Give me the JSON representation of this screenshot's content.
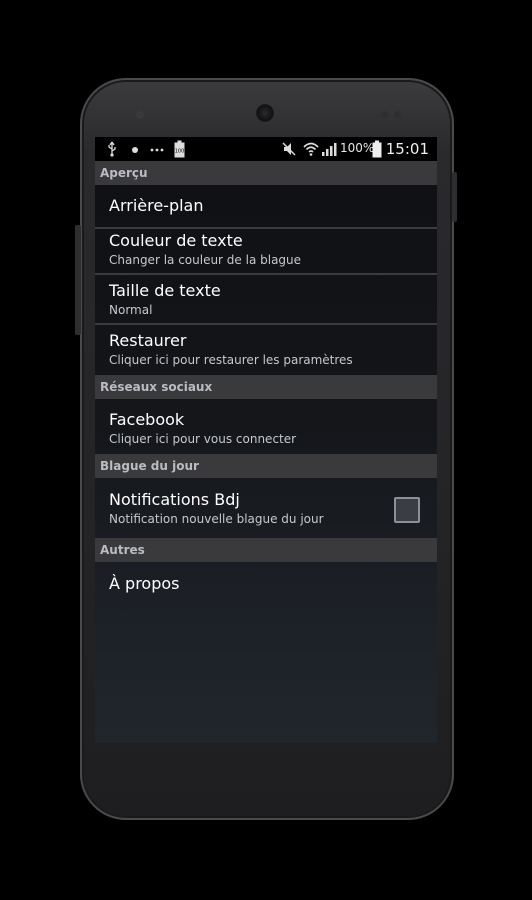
{
  "status_bar": {
    "icons_left": [
      "usb-icon",
      "dot-icon",
      "more-icon",
      "battery-saver-icon"
    ],
    "battery_saver_value": "100",
    "icons_right": [
      "mute-icon",
      "wifi-icon",
      "signal-icon",
      "battery-icon"
    ],
    "battery_text": "100%",
    "time": "15:01"
  },
  "sections": {
    "apercu": {
      "header": "Aperçu",
      "items": {
        "arriere_plan": {
          "title": "Arrière-plan"
        },
        "couleur": {
          "title": "Couleur de texte",
          "summary": "Changer la couleur de la blague"
        },
        "taille": {
          "title": "Taille de texte",
          "summary": "Normal"
        },
        "restaurer": {
          "title": "Restaurer",
          "summary": "Cliquer ici pour restaurer les paramètres"
        }
      }
    },
    "reseaux": {
      "header": "Réseaux sociaux",
      "items": {
        "facebook": {
          "title": "Facebook",
          "summary": "Cliquer ici pour vous connecter"
        }
      }
    },
    "blague": {
      "header": "Blague du jour",
      "items": {
        "notifications": {
          "title": "Notifications Bdj",
          "summary": "Notification nouvelle blague du jour",
          "checked": false
        }
      }
    },
    "autres": {
      "header": "Autres",
      "items": {
        "apropos": {
          "title": "À propos"
        }
      }
    }
  }
}
